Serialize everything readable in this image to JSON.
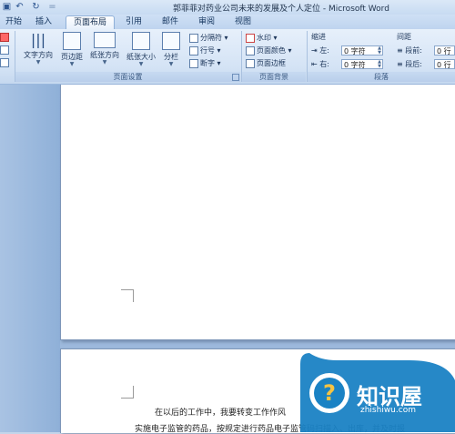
{
  "window": {
    "title": "郭菲菲对药业公司未来的发展及个人定位 - Microsoft Word"
  },
  "quick_access": {
    "undo_icon": "undo-icon",
    "redo_icon": "redo-icon",
    "separator": "="
  },
  "tabs": [
    {
      "label": "开始",
      "active": false
    },
    {
      "label": "插入",
      "active": false
    },
    {
      "label": "页面布局",
      "active": true
    },
    {
      "label": "引用",
      "active": false
    },
    {
      "label": "邮件",
      "active": false
    },
    {
      "label": "审阅",
      "active": false
    },
    {
      "label": "视图",
      "active": false
    }
  ],
  "ribbon": {
    "page_setup": {
      "label": "页面设置",
      "text_direction": "文字方向",
      "margins": "页边距",
      "orientation": "纸张方向",
      "size": "纸张大小",
      "columns": "分栏",
      "breaks": "分隔符",
      "line_numbers": "行号",
      "hyphenation": "断字"
    },
    "page_background": {
      "label": "页面背景",
      "watermark": "水印",
      "page_color": "页面颜色",
      "page_borders": "页面边框"
    },
    "indent": {
      "label": "缩进",
      "left_label": "左:",
      "left_value": "0 字符",
      "right_label": "右:",
      "right_value": "0 字符"
    },
    "spacing": {
      "label": "间距",
      "before_label": "段前:",
      "before_value": "0 行",
      "after_label": "段后:",
      "after_value": "0 行"
    },
    "paragraph_label": "段落"
  },
  "document": {
    "line1": "在以后的工作中，我要转变工作作风",
    "line2": "实施电子监管的药品，按规定进行药品电子监管码扫描入、出库，并及时报"
  },
  "watermark_logo": {
    "name": "知识屋",
    "url_text": "zhishiwu.com"
  },
  "colors": {
    "accent": "#1a82c4",
    "ribbon_bg": "#d4e3f5",
    "workspace": "#9db9dc"
  }
}
